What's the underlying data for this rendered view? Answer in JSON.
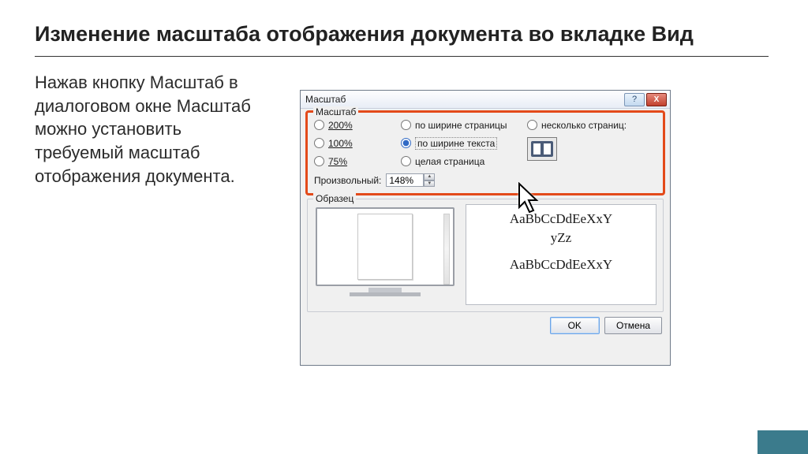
{
  "slide": {
    "title": "Изменение масштаба отображения документа во вкладке Вид",
    "body": "Нажав кнопку Масштаб в диалоговом окне Масштаб можно установить требуемый масштаб отображения документа."
  },
  "dialog": {
    "title": "Масштаб",
    "help_glyph": "?",
    "close_glyph": "X",
    "zoom_group": "Масштаб",
    "radios_col1": [
      "200%",
      "100%",
      "75%"
    ],
    "radios_col2": [
      "по ширине страницы",
      "по ширине текста",
      "целая страница"
    ],
    "radios_col3": "несколько страниц:",
    "selected_zoom": "по ширине текста",
    "custom_label": "Произвольный:",
    "custom_value": "148%",
    "sample_group": "Образец",
    "sample_line1": "AaBbCcDdEeXxY",
    "sample_line2": "yZz",
    "sample_line3": "AaBbCcDdEeXxY",
    "ok_label": "OK",
    "cancel_label": "Отмена"
  }
}
